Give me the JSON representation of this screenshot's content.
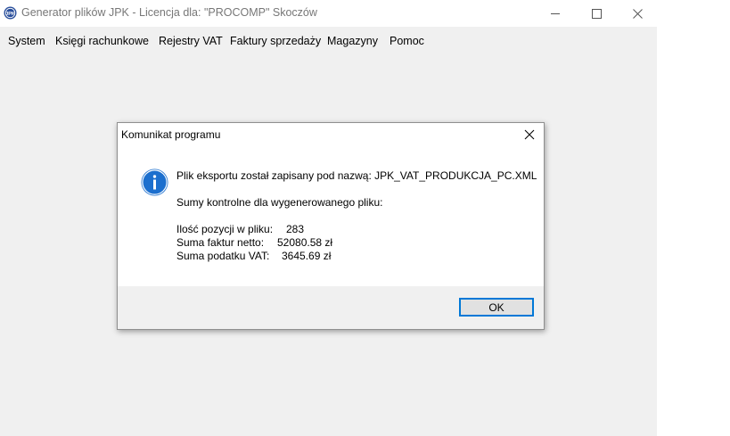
{
  "window": {
    "title": "Generator plików JPK - Licencja dla: \"PROCOMP\" Skoczów",
    "app_icon": "jpk-logo-icon",
    "controls": [
      "minimize-icon",
      "maximize-icon",
      "close-icon"
    ]
  },
  "menu": {
    "items": [
      "System",
      "Księgi rachunkowe",
      "Rejestry VAT",
      "Faktury sprzedaży",
      "Magazyny",
      "Pomoc"
    ]
  },
  "dialog": {
    "title": "Komunikat programu",
    "icon": "info-icon",
    "message": "Plik eksportu został zapisany pod nazwą: JPK_VAT_PRODUKCJA_PC.XML",
    "subtitle": "Sumy kontrolne dla wygenerowanego pliku:",
    "stats": [
      {
        "label": "Ilość pozycji w pliku:",
        "value": "283"
      },
      {
        "label": "Suma faktur netto:",
        "value": "52080.58 zł"
      },
      {
        "label": "Suma podatku VAT:",
        "value": "3645.69 zł"
      }
    ],
    "ok_label": "OK"
  },
  "colors": {
    "accent": "#0078d7",
    "info_blue": "#1c6fce",
    "window_bg": "#f0f0f0"
  }
}
